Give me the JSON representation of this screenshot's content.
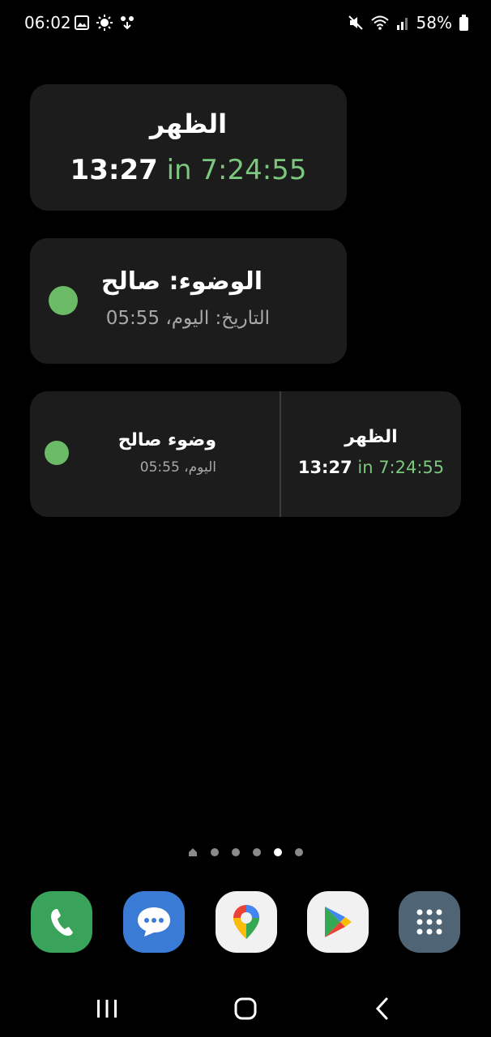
{
  "status_bar": {
    "time": "06:02",
    "battery": "58%",
    "icons": [
      "gallery-icon",
      "brightness-icon",
      "download-icon",
      "mute-icon",
      "wifi-icon",
      "signal-icon",
      "battery-icon"
    ]
  },
  "widget_prayer": {
    "prayer_name": "الظهر",
    "prayer_time": "13:27",
    "countdown": "in 7:24:55"
  },
  "widget_wudu": {
    "title": "الوضوء: صالح",
    "subtitle": "التاريخ: اليوم، 05:55",
    "status_color": "#6bba65"
  },
  "widget_combined": {
    "wudu_title": "وضوء صالح",
    "wudu_subtitle": "اليوم، 05:55",
    "prayer_name": "الظهر",
    "prayer_time": "13:27",
    "countdown": "in 7:24:55"
  },
  "page_indicator": {
    "pages": 6,
    "active_index": 4
  },
  "dock": {
    "apps": [
      "phone-icon",
      "messages-icon",
      "maps-icon",
      "play-store-icon",
      "app-drawer-icon"
    ]
  },
  "nav_bar": {
    "buttons": [
      "recents",
      "home",
      "back"
    ]
  },
  "colors": {
    "accent_green": "#7bc77d",
    "widget_bg": "#1c1c1c"
  }
}
